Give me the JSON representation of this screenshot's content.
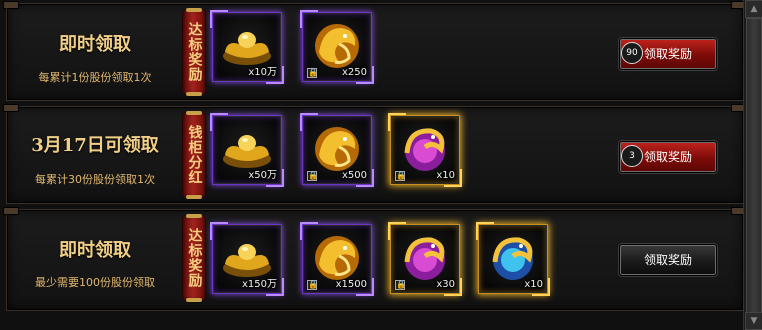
{
  "rows": [
    {
      "title": "即时领取",
      "subtitle": "每累计1份股份领取1次",
      "banner": "达标奖励",
      "rewards": [
        {
          "name": "gold-ingot",
          "qty": "x10万",
          "locked": false,
          "frame": "purple"
        },
        {
          "name": "golden-dragon",
          "qty": "x250",
          "locked": true,
          "frame": "purple"
        }
      ],
      "button": {
        "label": "领取奖励",
        "count": "90",
        "style": "red"
      }
    },
    {
      "title": "3月17日可领取",
      "subtitle": "每累计30份股份领取1次",
      "banner": "钱柜分红",
      "rewards": [
        {
          "name": "gold-ingot",
          "qty": "x50万",
          "locked": false,
          "frame": "purple"
        },
        {
          "name": "golden-dragon",
          "qty": "x500",
          "locked": true,
          "frame": "purple"
        },
        {
          "name": "purple-dragon",
          "qty": "x10",
          "locked": true,
          "frame": "gold"
        }
      ],
      "button": {
        "label": "领取奖励",
        "count": "3",
        "style": "red"
      }
    },
    {
      "title": "即时领取",
      "subtitle": "最少需要100份股份领取",
      "banner": "达标奖励",
      "rewards": [
        {
          "name": "gold-ingot",
          "qty": "x150万",
          "locked": false,
          "frame": "purple"
        },
        {
          "name": "golden-dragon",
          "qty": "x1500",
          "locked": true,
          "frame": "purple"
        },
        {
          "name": "purple-dragon",
          "qty": "x30",
          "locked": true,
          "frame": "gold"
        },
        {
          "name": "blue-dragon",
          "qty": "x10",
          "locked": false,
          "frame": "gold"
        }
      ],
      "button": {
        "label": "领取奖励",
        "count": "",
        "style": "dark"
      }
    }
  ],
  "icons": {
    "lock": "🔒",
    "scroll_up": "▲",
    "scroll_down": "▼"
  }
}
